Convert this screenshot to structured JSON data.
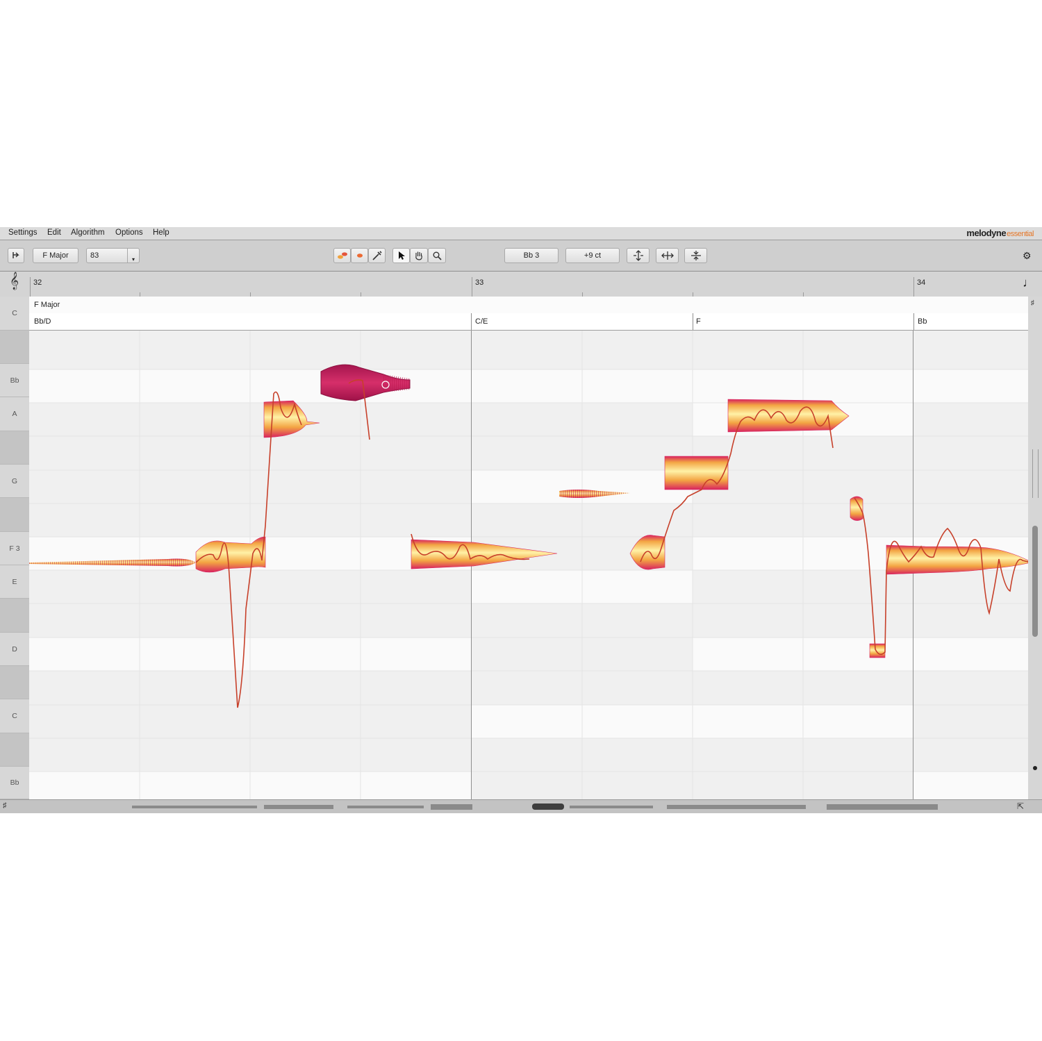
{
  "menu": {
    "items": [
      "Settings",
      "Edit",
      "Algorithm",
      "Options",
      "Help"
    ]
  },
  "brand": {
    "name": "melodyne",
    "edition": "essential",
    "accent": "#e6782a"
  },
  "toolbar": {
    "key_label": "F Major",
    "tempo_value": "83",
    "pitch_readout": "Bb 3",
    "cents_readout": "+9 ct",
    "tools": [
      "undo-icon",
      "blob-view-icon",
      "pitch-mode-icon",
      "macro-icon",
      "pointer-icon",
      "hand-icon",
      "zoom-icon",
      "pitch-align-icon",
      "time-align-icon",
      "amplitude-icon",
      "gear-icon"
    ]
  },
  "ruler": {
    "bars": [
      "32",
      "33",
      "34"
    ]
  },
  "editor": {
    "scale": "F Major",
    "chords": [
      "Bb/D",
      "C/E",
      "F",
      "Bb"
    ],
    "keyboard_labels": [
      "C",
      "Bb",
      "A",
      "G",
      "F 3",
      "E",
      "D",
      "C",
      "Bb"
    ]
  },
  "colors": {
    "blob_light": "#fff1a6",
    "blob_mid": "#f3a543",
    "blob_dark": "#d8245f",
    "selected_blob": "#c8205f",
    "pitch_curve": "#c7402a"
  }
}
